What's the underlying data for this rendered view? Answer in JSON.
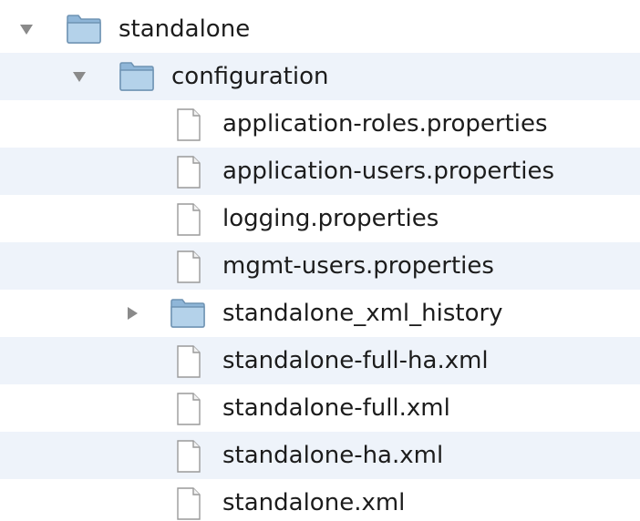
{
  "tree": {
    "items": [
      {
        "label": "standalone",
        "kind": "folder",
        "depth": 0,
        "state": "expanded",
        "icon": "folder-icon"
      },
      {
        "label": "configuration",
        "kind": "folder",
        "depth": 1,
        "state": "expanded",
        "icon": "folder-icon"
      },
      {
        "label": "application-roles.properties",
        "kind": "file",
        "depth": 2,
        "icon": "document-icon"
      },
      {
        "label": "application-users.properties",
        "kind": "file",
        "depth": 2,
        "icon": "document-icon"
      },
      {
        "label": "logging.properties",
        "kind": "file",
        "depth": 2,
        "icon": "document-icon"
      },
      {
        "label": "mgmt-users.properties",
        "kind": "file",
        "depth": 2,
        "icon": "document-icon"
      },
      {
        "label": "standalone_xml_history",
        "kind": "folder",
        "depth": 2,
        "state": "collapsed",
        "icon": "folder-icon"
      },
      {
        "label": "standalone-full-ha.xml",
        "kind": "file",
        "depth": 2,
        "icon": "document-icon"
      },
      {
        "label": "standalone-full.xml",
        "kind": "file",
        "depth": 2,
        "icon": "document-icon"
      },
      {
        "label": "standalone-ha.xml",
        "kind": "file",
        "depth": 2,
        "icon": "document-icon"
      },
      {
        "label": "standalone.xml",
        "kind": "file",
        "depth": 2,
        "icon": "document-icon"
      }
    ]
  },
  "colors": {
    "row_stripe": "#eef3fa",
    "text": "#1c1c1c",
    "folder_fill": "#a9cbe6",
    "folder_stroke": "#6f93b3",
    "disclosure_triangle": "#8a8a8a"
  }
}
